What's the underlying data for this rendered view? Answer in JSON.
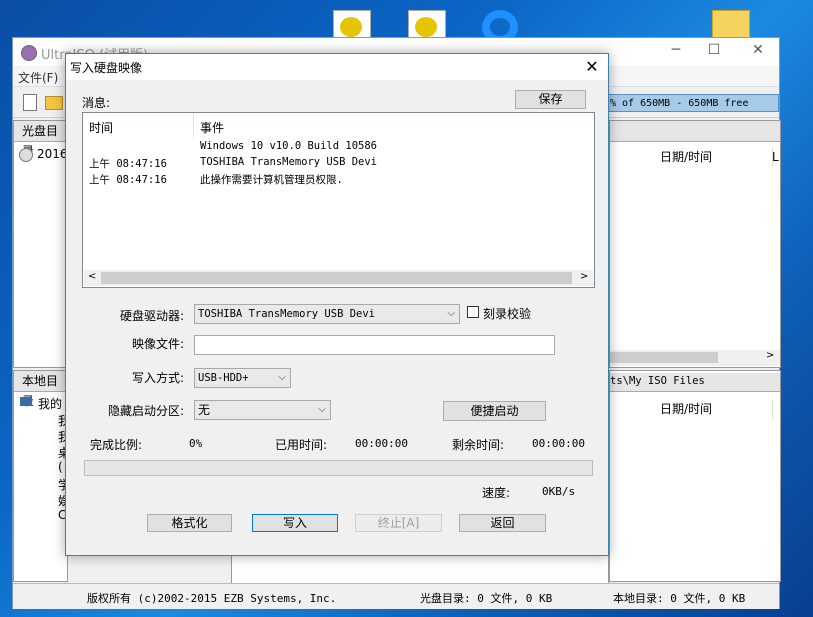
{
  "main_window": {
    "title": "UltraISO (试用版)",
    "menu_file": "文件(F)",
    "size_info": "% of 650MB - 650MB free",
    "left_top_header": "光盘目录",
    "left_top_item": "20160",
    "right_top_columns": {
      "datetime": "日期/时间",
      "last": "L"
    },
    "left_bottom_header": "本地目录",
    "right_bottom_path": "ts\\My ISO Files",
    "right_bottom_columns": {
      "datetime": "日期/时间"
    },
    "tree_items": [
      "我的",
      "我",
      "我",
      "桌",
      "(",
      "学",
      "娱",
      "C"
    ],
    "status": {
      "copyright": "版权所有 (c)2002-2015 EZB Systems, Inc.",
      "disc": "光盘目录: 0 文件, 0 KB",
      "local": "本地目录: 0 文件, 0 KB"
    }
  },
  "dialog": {
    "title": "写入硬盘映像",
    "close_glyph": "✕",
    "messages_label": "消息:",
    "save_button": "保存",
    "log": {
      "col_time": "时间",
      "col_event": "事件",
      "rows": [
        {
          "time": "",
          "event": "Windows 10 v10.0 Build 10586"
        },
        {
          "time": "上午 08:47:16",
          "event": "TOSHIBA TransMemory USB Devi"
        },
        {
          "time": "上午 08:47:16",
          "event": "此操作需要计算机管理员权限."
        }
      ]
    },
    "drive_label": "硬盘驱动器:",
    "drive_value": "TOSHIBA TransMemory USB Devi",
    "verify_label": "刻录校验",
    "verify_checked": false,
    "image_label": "映像文件:",
    "image_value": "",
    "write_mode_label": "写入方式:",
    "write_mode_value": "USB-HDD+",
    "hidden_part_label": "隐藏启动分区:",
    "hidden_part_value": "无",
    "convenient_boot_button": "便捷启动",
    "progress_label": "完成比例:",
    "progress_value": "0%",
    "progress_fraction": 0,
    "elapsed_label": "已用时间:",
    "elapsed_value": "00:00:00",
    "remaining_label": "剩余时间:",
    "remaining_value": "00:00:00",
    "speed_label": "速度:",
    "speed_value": "0KB/s",
    "buttons": {
      "format": "格式化",
      "write": "写入",
      "abort": "终止[A]",
      "back": "返回"
    }
  }
}
